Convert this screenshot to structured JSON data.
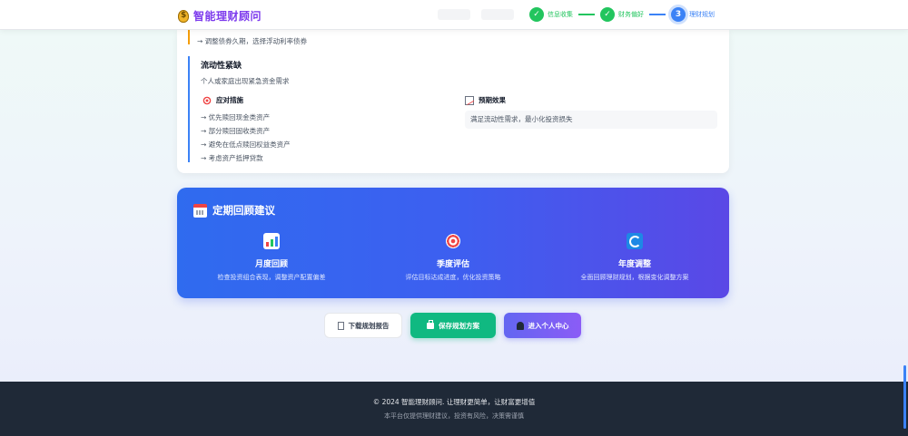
{
  "app": {
    "title": "智能理财顾问"
  },
  "steps": [
    {
      "label": "信息收集",
      "state": "done",
      "marker": "✓"
    },
    {
      "label": "财务偏好",
      "state": "done",
      "marker": "✓"
    },
    {
      "label": "理财规划",
      "state": "active",
      "marker": "3"
    }
  ],
  "previous_item": {
    "text": "→ 调整债券久期，选择浮动利率债券"
  },
  "risk": {
    "title": "流动性紧缺",
    "description": "个人或家庭出现紧急资金需求",
    "measures_label": "应对措施",
    "effect_label": "预期效果",
    "measures": [
      "→ 优先赎回现金类资产",
      "→ 部分赎回固收类资产",
      "→ 避免在低点赎回权益类资产",
      "→ 考虑资产抵押贷款"
    ],
    "effect": "满足流动性需求，最小化投资损失"
  },
  "review": {
    "title": "定期回顾建议",
    "items": [
      {
        "icon": "bar-chart-icon",
        "title": "月度回顾",
        "desc": "检查投资组合表现，调整资产配置偏差"
      },
      {
        "icon": "target-icon",
        "title": "季度评估",
        "desc": "评估目标达成进度，优化投资策略"
      },
      {
        "icon": "refresh-icon",
        "title": "年度调整",
        "desc": "全面回顾理财规划，根据变化调整方案"
      }
    ]
  },
  "actions": {
    "download": "下载规划报告",
    "save": "保存规划方案",
    "center": "进入个人中心"
  },
  "footer": {
    "line1": "© 2024 智能理财顾问. 让理财更简单，让财富更增值",
    "line2": "本平台仅提供理财建议，投资有风险，决策需谨慎"
  },
  "colors": {
    "brand": "#7c3aed",
    "done": "#22c55e",
    "active": "#3b82f6",
    "save": "#10b981",
    "footer_bg": "#1f2937"
  }
}
